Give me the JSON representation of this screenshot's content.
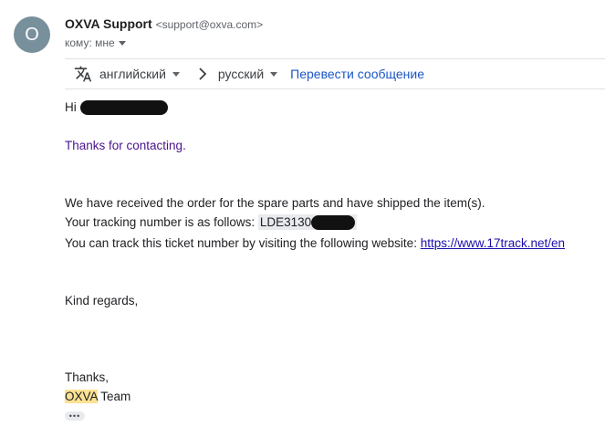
{
  "sender": {
    "avatar_letter": "O",
    "name": "OXVA Support",
    "email": "<support@oxva.com>",
    "to_label": "кому: мне"
  },
  "translate_bar": {
    "icon": "translate-icon",
    "source_lang": "английский",
    "target_lang": "русский",
    "translate_link": "Перевести сообщение"
  },
  "message": {
    "greeting": "Hi",
    "thanks_contacting": "Thanks for contacting.",
    "line_received": "We have received the order for the spare parts and have shipped the item(s).",
    "tracking_prefix": "Your tracking number is as follows: ",
    "tracking_number_visible": "LDE3130",
    "track_text": "You can track this ticket number by visiting the following website: ",
    "track_url": "https://www.17track.net/en",
    "regards": "Kind regards,",
    "thanks": "Thanks,",
    "sig_brand": "OXVA",
    "sig_team": " Team",
    "more_dots": "•••"
  },
  "colors": {
    "avatar_bg": "#78909c",
    "link": "#1a0dab",
    "translate_link": "#1a56c4",
    "purple_text": "#4a148c",
    "highlight": "#fde293"
  }
}
